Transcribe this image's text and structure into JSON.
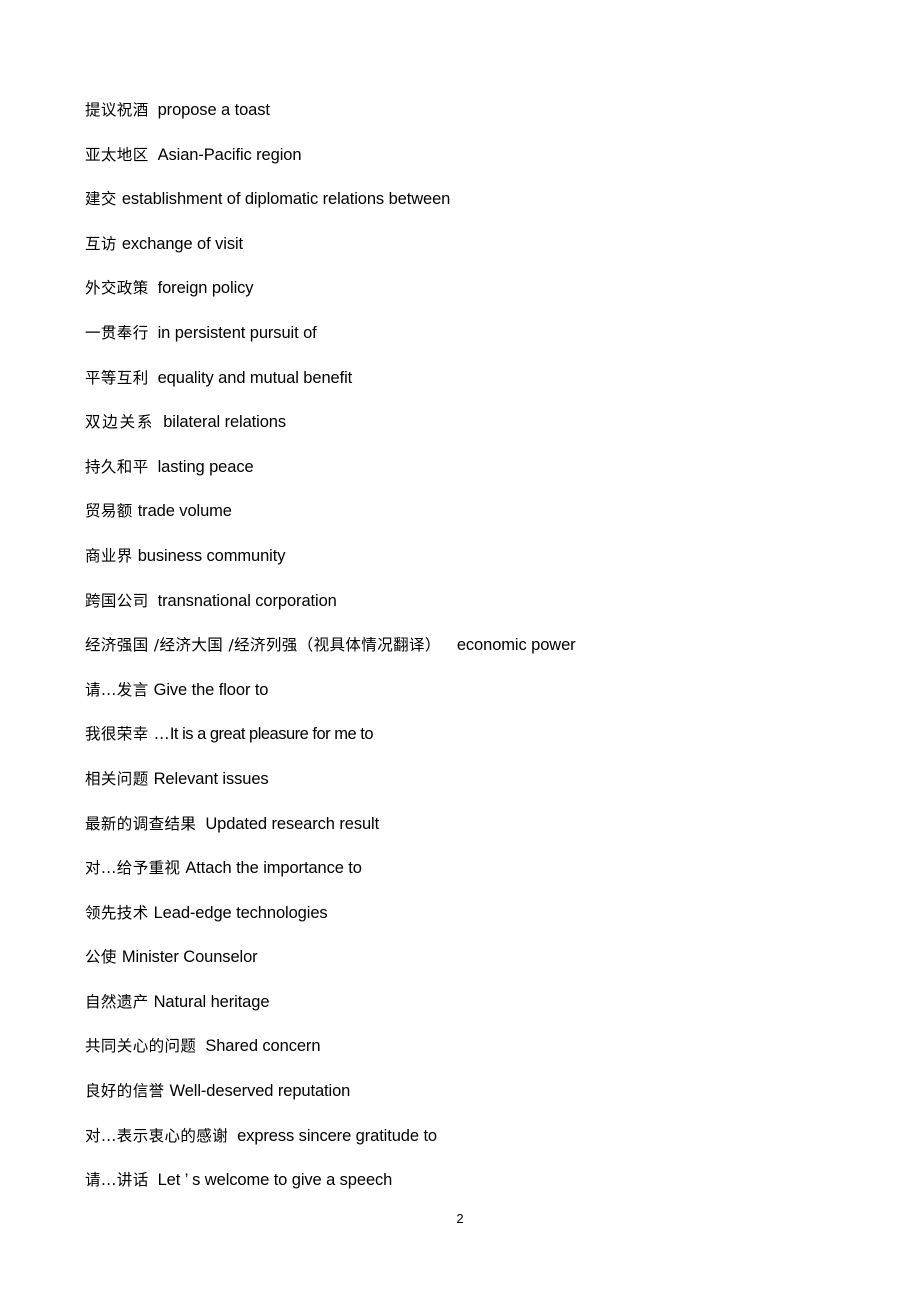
{
  "document": {
    "page_number": "2",
    "entries": [
      {
        "term": "提议祝酒",
        "definition": "propose a toast",
        "gap": "md"
      },
      {
        "term": "亚太地区",
        "definition": "Asian-Pacific region",
        "gap": "md"
      },
      {
        "term": "建交",
        "definition": "establishment of diplomatic relations between",
        "gap": "sm"
      },
      {
        "term": "互访",
        "definition": "exchange of visit",
        "gap": "sm"
      },
      {
        "term": "外交政策",
        "definition": "foreign policy",
        "gap": "md"
      },
      {
        "term": "一贯奉行",
        "definition": "in persistent pursuit of",
        "gap": "md"
      },
      {
        "term": "平等互利",
        "definition": "equality and mutual benefit",
        "gap": "md"
      },
      {
        "term": "双边关系",
        "definition": "bilateral relations",
        "gap": "md",
        "wide": true
      },
      {
        "term": "持久和平",
        "definition": "lasting peace",
        "gap": "md"
      },
      {
        "term": "贸易额",
        "definition": "trade volume",
        "gap": "sm"
      },
      {
        "term": "商业界",
        "definition": "business community",
        "gap": "sm"
      },
      {
        "term": "跨国公司",
        "definition": "transnational corporation",
        "gap": "md"
      },
      {
        "term": "经济强国 /经济大国 /经济列强（视具体情况翻译）",
        "definition": "economic power",
        "gap": "lg"
      },
      {
        "term": "请…发言",
        "definition": "Give the floor to",
        "gap": "sm"
      },
      {
        "term": "我很荣幸 …",
        "definition": "It is a great pleasure for me to",
        "gap": "none",
        "tight": true
      },
      {
        "term": "相关问题",
        "definition": "Relevant issues",
        "gap": "sm"
      },
      {
        "term": "最新的调查结果",
        "definition": "Updated research result",
        "gap": "md"
      },
      {
        "term": "对…给予重视",
        "definition": "Attach the importance to",
        "gap": "sm"
      },
      {
        "term": "领先技术",
        "definition": "Lead-edge technologies",
        "gap": "sm"
      },
      {
        "term": "公使",
        "definition": "Minister Counselor",
        "gap": "sm"
      },
      {
        "term": "自然遗产",
        "definition": "Natural heritage",
        "gap": "sm"
      },
      {
        "term": "共同关心的问题",
        "definition": "Shared concern",
        "gap": "md"
      },
      {
        "term": "良好的信誉",
        "definition": "Well-deserved reputation",
        "gap": "sm"
      },
      {
        "term": "对…表示衷心的感谢",
        "definition": "express sincere gratitude to",
        "gap": "md"
      },
      {
        "term": "请…讲话",
        "definition": "Let ’ s welcome to give a speech",
        "gap": "md"
      }
    ]
  }
}
